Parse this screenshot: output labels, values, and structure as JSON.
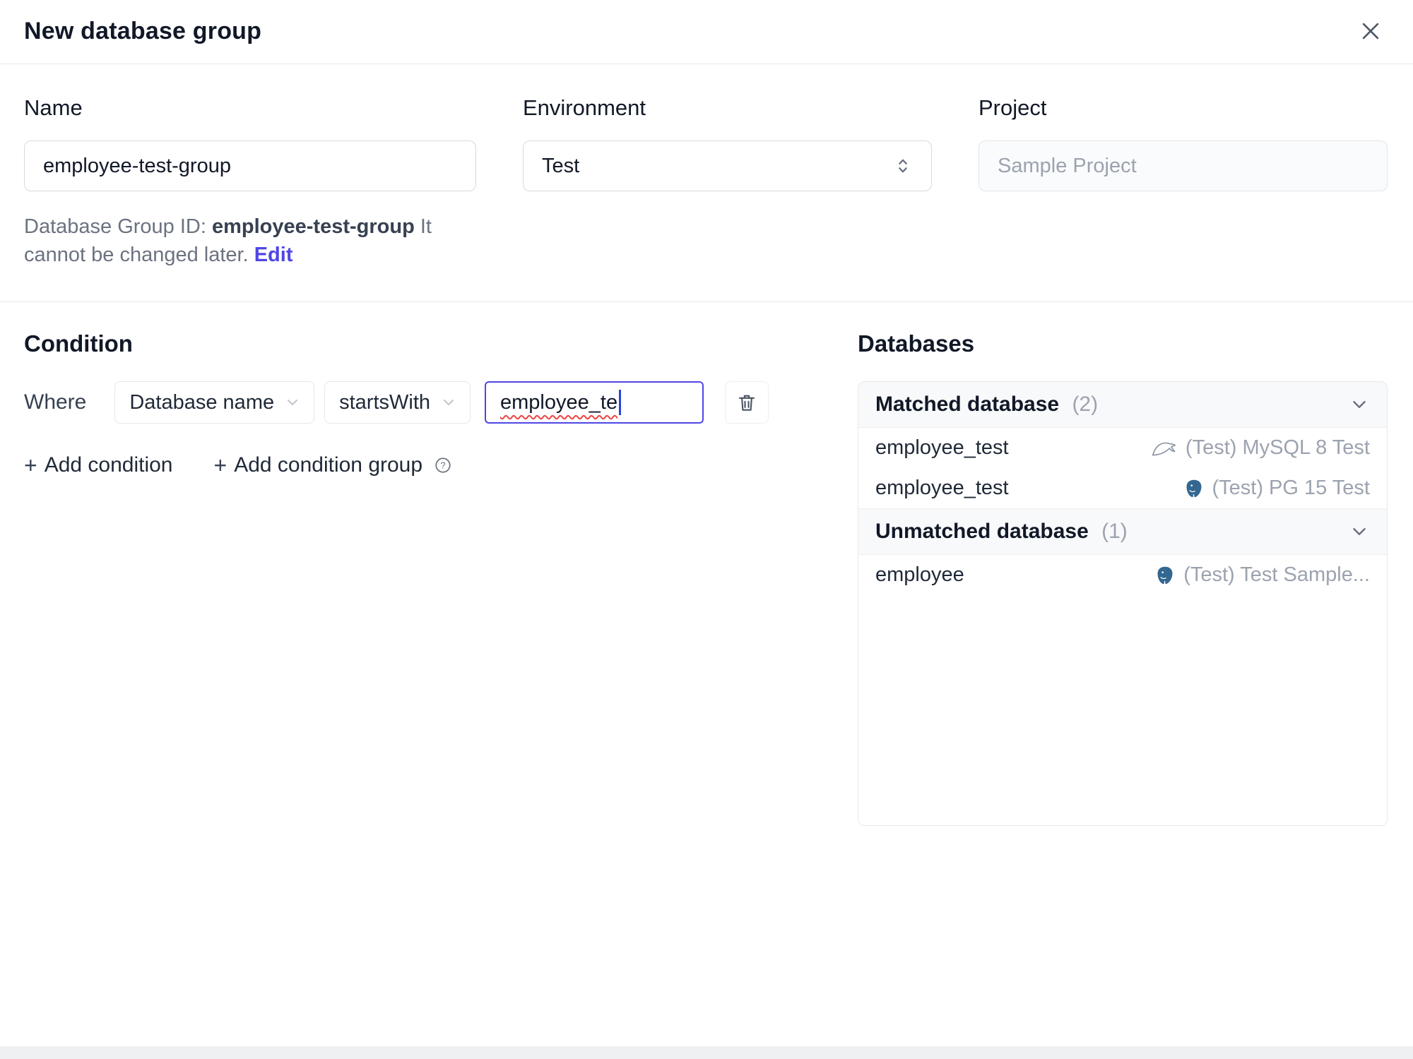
{
  "dialog": {
    "title": "New database group"
  },
  "form": {
    "name_label": "Name",
    "name_value": "employee-test-group",
    "environment_label": "Environment",
    "environment_value": "Test",
    "project_label": "Project",
    "project_value": "Sample Project",
    "group_id_prefix": "Database Group ID:",
    "group_id_value": "employee-test-group",
    "group_id_note": "It cannot be changed later.",
    "edit_link": "Edit"
  },
  "condition": {
    "heading": "Condition",
    "where_label": "Where",
    "field_select": "Database name",
    "operator_select": "startsWith",
    "value_input": "employee_te",
    "add_condition_label": "Add condition",
    "add_condition_group_label": "Add condition group"
  },
  "databases": {
    "heading": "Databases",
    "sections": [
      {
        "title": "Matched database",
        "count": "(2)",
        "rows": [
          {
            "name": "employee_test",
            "engine": "mysql-icon",
            "instance": "(Test) MySQL 8 Test"
          },
          {
            "name": "employee_test",
            "engine": "postgres-icon",
            "instance": "(Test) PG 15 Test"
          }
        ]
      },
      {
        "title": "Unmatched database",
        "count": "(1)",
        "rows": [
          {
            "name": "employee",
            "engine": "postgres-icon",
            "instance": "(Test) Test Sample..."
          }
        ]
      }
    ]
  },
  "icons": {
    "plus": "+"
  },
  "colors": {
    "accent": "#4f46e5",
    "focus_border": "#4f46e5",
    "error_underline": "#ef4444",
    "mysql": "#7b8794",
    "postgres": "#336791"
  }
}
